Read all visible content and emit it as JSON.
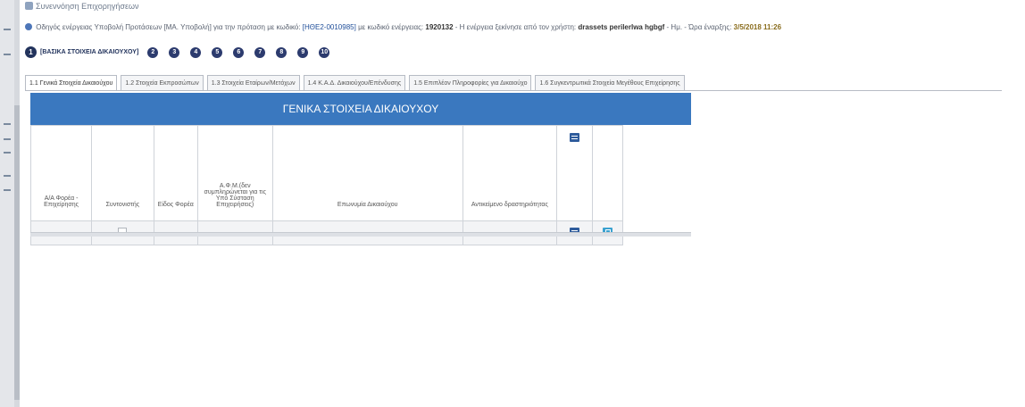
{
  "header": {
    "title": "Συνεννόηση Επιχορηγήσεων",
    "info": {
      "prefix": "Οδηγός ενέργειας Υποβολή Προτάσεων [ΜΑ. Υποβολή] για την πρόταση με κωδικό:",
      "code": "[ΗΘΕ2-0010985]",
      "mid": "με κωδικό ενέργειας:",
      "action_code": "1920132",
      "user_prefix": "- Η ενέργεια ξεκίνησε από τον χρήστη:",
      "user": "drassets perilerlwa hgbgf",
      "start_prefix": "- Ημ. - Ώρα έναρξης:",
      "start": "3/5/2018 11:26"
    }
  },
  "steps": {
    "active_number": "1",
    "active_label": "[ΒΑΣΙΚΑ ΣΤΟΙΧΕΙΑ ΔΙΚΑΙΟΥΧΟΥ]",
    "others": [
      "2",
      "3",
      "4",
      "5",
      "6",
      "7",
      "8",
      "9",
      "10"
    ]
  },
  "tabs": [
    "1.1 Γενικά Στοιχεία Δικαιούχου",
    "1.2 Στοιχεία Εκπροσώπων",
    "1.3 Στοιχεία Εταίρων/Μετόχων",
    "1.4 Κ.Α.Δ. Δικαιούχου/Επένδυσης",
    "1.5 Επιπλέον Πληροφορίες για Δικαιούχο",
    "1.6 Συγκεντρωτικά Στοιχεία Μεγέθους Επιχείρησης"
  ],
  "panel": {
    "title": "ΓΕΝΙΚΑ ΣΤΟΙΧΕΙΑ ΔΙΚΑΙΟΥΧΟΥ",
    "columns": [
      "Α/Α Φορέα - Επιχείρησης",
      "Συντονιστής",
      "Είδος Φορέα",
      "Α.Φ.Μ.(δεν συμπληρώνεται για τις Υπό Σύσταση Επιχειρήσεις)",
      "Επωνυμία Δικαιούχου",
      "Αντικείμενο δραστηριότητας"
    ]
  },
  "icons": {
    "add": "add-icon",
    "edit": "edit-icon",
    "open": "open-icon"
  },
  "colors": {
    "header_blue": "#3a78bf",
    "step_navy": "#22335c"
  }
}
